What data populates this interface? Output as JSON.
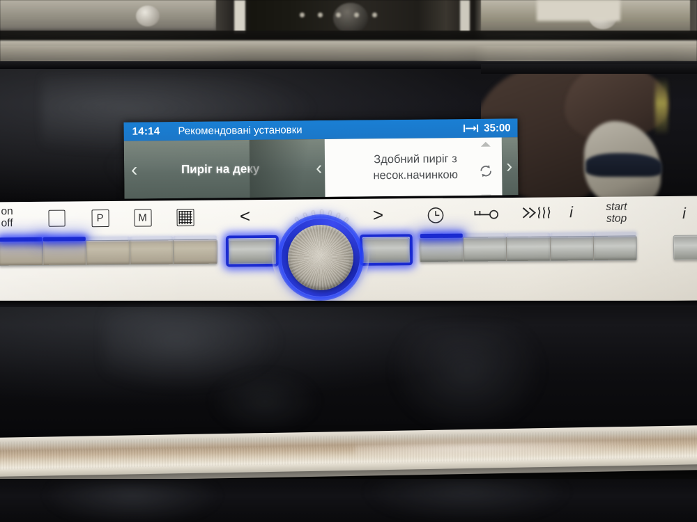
{
  "device": {
    "type": "built-in-oven-control-panel",
    "brand_accent_color": "#1b77c8",
    "led_color": "#1a2ad0"
  },
  "display": {
    "clock": "14:14",
    "title": "Рекомендовані установки",
    "duration_icon": "duration-icon",
    "duration": "35:00",
    "mode_prev_icon": "chevron-left-icon",
    "mode_name": "Пиріг на деку",
    "recipe_prev_icon": "chevron-left-icon",
    "recipe_line1": "Здобний пиріг з",
    "recipe_line2": "несок.начинкою",
    "scroll_up_icon": "triangle-up-icon",
    "cycle_icon": "cycle-arrows-icon",
    "scroll_down_icon": "triangle-down-icon",
    "recipe_next_icon": "chevron-right-icon"
  },
  "panel": {
    "left_buttons": [
      {
        "name": "on-off",
        "label_line1": "on",
        "label_line2": "off",
        "icon": "power-text",
        "led": "bright"
      },
      {
        "name": "oven-function",
        "label": "",
        "icon": "square-icon",
        "led": "bright"
      },
      {
        "name": "programs",
        "label": "P",
        "icon": "letter-p-icon",
        "led": "dim"
      },
      {
        "name": "memory",
        "label": "M",
        "icon": "letter-m-icon",
        "led": "dim"
      },
      {
        "name": "grid-menu",
        "label": "",
        "icon": "grid-icon",
        "led": "dim"
      }
    ],
    "nav_prev": {
      "name": "navigate-left",
      "label": "<",
      "icon": "chevron-left-icon",
      "led": "bright"
    },
    "nav_next": {
      "name": "navigate-right",
      "label": ">",
      "icon": "chevron-right-icon",
      "led": "bright"
    },
    "knob": {
      "name": "rotary-selector",
      "illuminated": true,
      "tick_count": 7
    },
    "right_buttons": [
      {
        "name": "timer",
        "label": "",
        "icon": "clock-icon",
        "led": "bright"
      },
      {
        "name": "child-lock",
        "label": "",
        "icon": "key-icon",
        "led": "dim"
      },
      {
        "name": "fast-preheat",
        "label": "≫∫∫∫",
        "icon": "fast-heat-icon",
        "led": "dim"
      },
      {
        "name": "info",
        "label": "i",
        "icon": "info-icon",
        "led": "dim"
      },
      {
        "name": "start-stop",
        "label_line1": "start",
        "label_line2": "stop",
        "icon": "start-stop-text",
        "led": "dim"
      }
    ],
    "edge_button": {
      "name": "light",
      "label": "i",
      "icon": "info-icon-partial",
      "led": "none"
    }
  }
}
